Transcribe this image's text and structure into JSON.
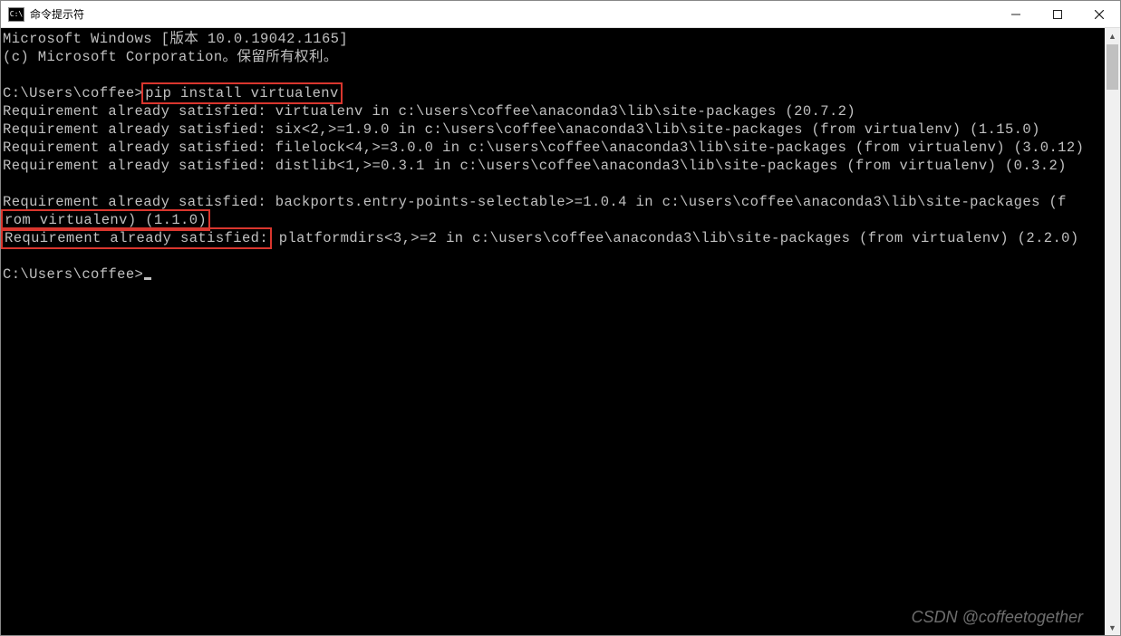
{
  "window": {
    "title": "命令提示符",
    "icon_label": "C:\\"
  },
  "terminal": {
    "header1": "Microsoft Windows [版本 10.0.19042.1165]",
    "header2": "(c) Microsoft Corporation。保留所有权利。",
    "prompt1_prefix": "C:\\Users\\coffee>",
    "prompt1_cmd": "pip install virtualenv",
    "out_line1": "Requirement already satisfied: virtualenv in c:\\users\\coffee\\anaconda3\\lib\\site-packages (20.7.2)",
    "out_line2": "Requirement already satisfied: six<2,>=1.9.0 in c:\\users\\coffee\\anaconda3\\lib\\site-packages (from virtualenv) (1.15.0)",
    "out_line3": "Requirement already satisfied: filelock<4,>=3.0.0 in c:\\users\\coffee\\anaconda3\\lib\\site-packages (from virtualenv) (3.0.12)",
    "out_line4": "Requirement already satisfied: distlib<1,>=0.3.1 in c:\\users\\coffee\\anaconda3\\lib\\site-packages (from virtualenv) (0.3.2)",
    "out_line5a": "Requirement already satisfied: backports.entry-points-selectable>=1.0.4 in c:\\users\\coffee\\anaconda3\\lib\\site-packages (f",
    "out_line5b": "rom virtualenv) (1.1.0)",
    "out_line6_hl": "Requirement already satisfied:",
    "out_line6_rest": " platformdirs<3,>=2 in c:\\users\\coffee\\anaconda3\\lib\\site-packages (from virtualenv) (2.2.0)",
    "prompt2": "C:\\Users\\coffee>"
  },
  "watermark": "CSDN @coffeetogether"
}
